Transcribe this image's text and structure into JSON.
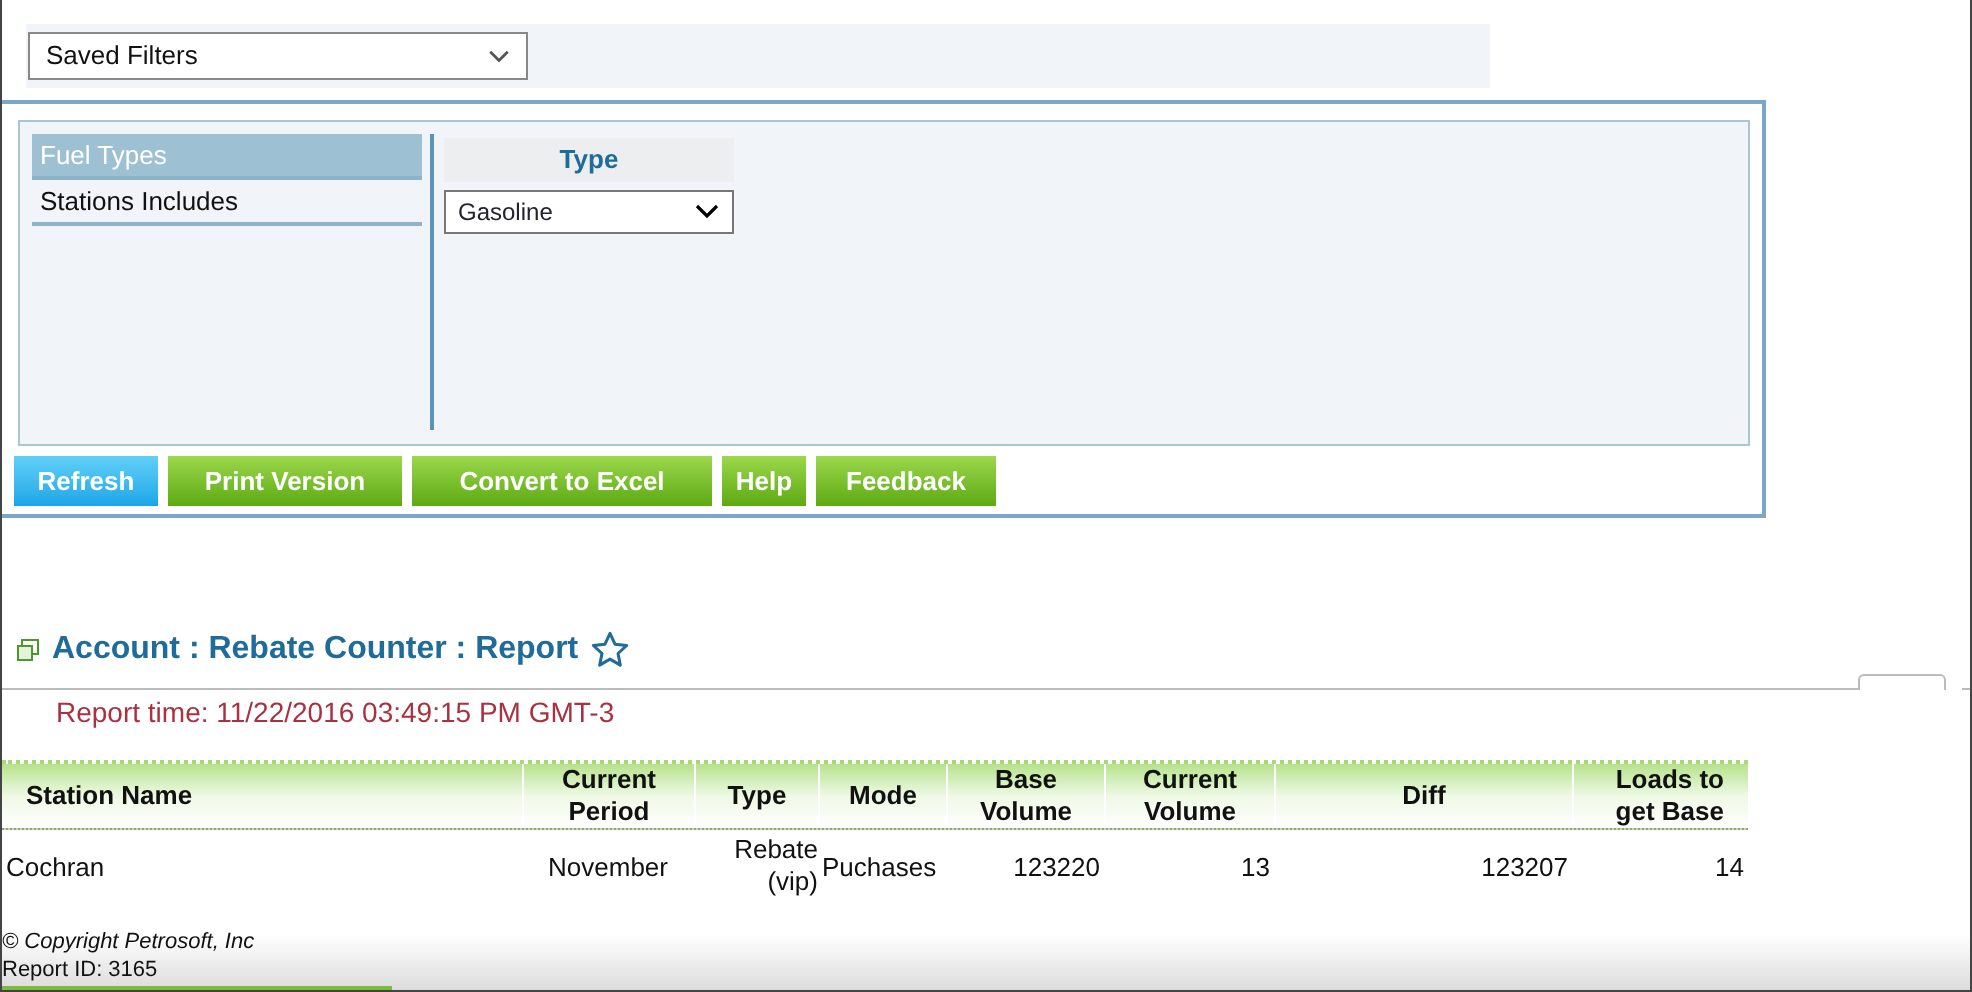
{
  "saved_filters": {
    "value": "Saved Filters"
  },
  "filter_panel": {
    "categories": [
      {
        "label": "Fuel Types",
        "selected": true
      },
      {
        "label": "Stations Includes",
        "selected": false
      }
    ],
    "type_header": "Type",
    "type_select": {
      "value": "Gasoline"
    }
  },
  "buttons": [
    {
      "label": "Refresh",
      "kind": "primary"
    },
    {
      "label": "Print Version",
      "kind": "secondary"
    },
    {
      "label": "Convert to Excel",
      "kind": "secondary"
    },
    {
      "label": "Help",
      "kind": "secondary"
    },
    {
      "label": "Feedback",
      "kind": "secondary"
    }
  ],
  "report": {
    "title": "Account : Rebate Counter : Report",
    "favorite": false,
    "report_time": "Report time: 11/22/2016 03:49:15 PM GMT-3"
  },
  "table": {
    "columns": [
      "Station Name",
      "Current Period",
      "Type",
      "Mode",
      "Base Volume",
      "Current Volume",
      "Diff",
      "Loads to get Base"
    ],
    "rows": [
      [
        "Cochran",
        "November",
        "Rebate (vip)",
        "Puchases",
        "123220",
        "13",
        "123207",
        "14"
      ]
    ]
  },
  "footer": {
    "copyright": "© Copyright Petrosoft, Inc",
    "report_id": "Report ID: 3165"
  }
}
